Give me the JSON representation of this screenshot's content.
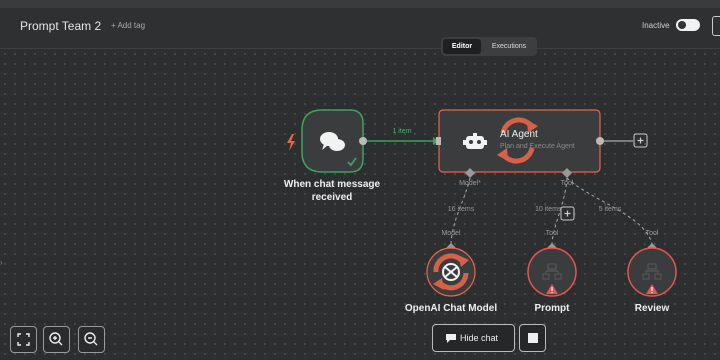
{
  "header": {
    "workflow_title": "Prompt Team 2",
    "add_tag": "+ Add tag",
    "inactive_label": "Inactive",
    "tabs": [
      {
        "label": "Editor"
      },
      {
        "label": "Executions"
      }
    ]
  },
  "nodes": {
    "trigger": {
      "label_line1": "When chat message",
      "label_line2": "received"
    },
    "agent": {
      "title": "AI Agent",
      "subtitle": "Plan and Execute Agent"
    },
    "openai": {
      "label": "OpenAI Chat Model"
    },
    "prompt": {
      "label": "Prompt"
    },
    "review": {
      "label": "Review"
    }
  },
  "connections": {
    "trigger_to_agent": "1 item",
    "model_port": "Model*",
    "tool_port": "Tool",
    "model_items": "16 items",
    "prompt_items": "10 items",
    "review_items": "5 items",
    "openai_port": "Model",
    "prompt_port": "Tool",
    "review_port": "Tool"
  },
  "footer": {
    "hide_chat": "Hide chat"
  },
  "colors": {
    "accent_orange": "#e8664a",
    "trigger_green": "#3fa45a",
    "warn_red": "#e8554f"
  },
  "icons": [
    "lightning-icon",
    "chat-bubbles-icon",
    "check-icon",
    "robot-icon",
    "refresh-icon",
    "plus-icon",
    "openai-icon",
    "warning-icon",
    "fit-view-icon",
    "zoom-in-icon",
    "zoom-out-icon",
    "chat-icon",
    "stop-icon"
  ]
}
